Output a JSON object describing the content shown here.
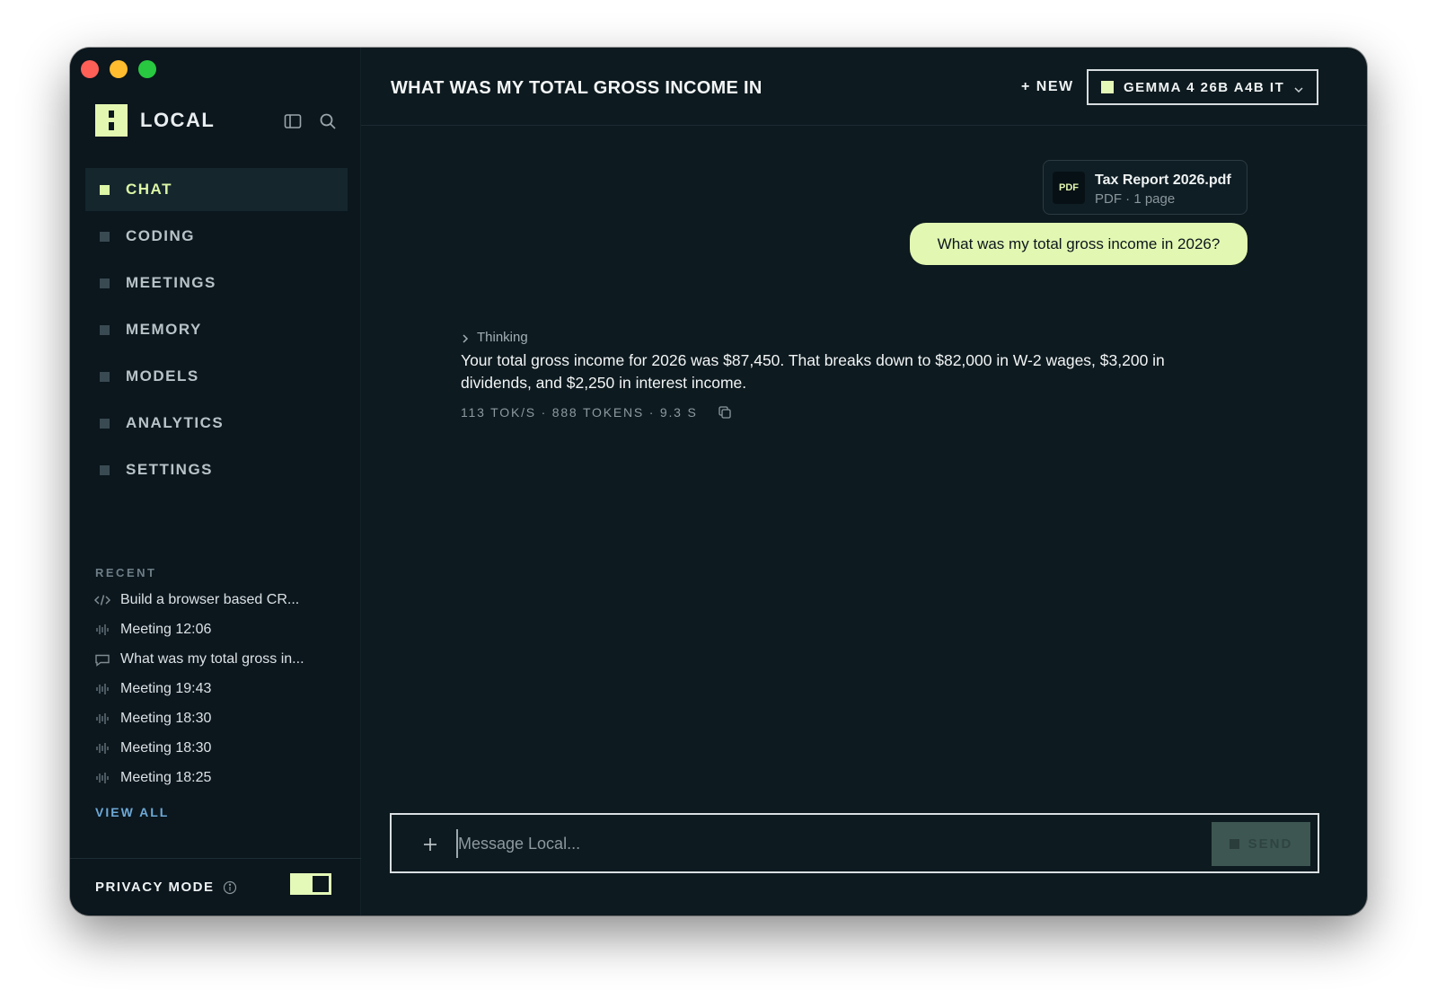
{
  "app": {
    "name": "LOCAL"
  },
  "sidebar": {
    "nav": [
      {
        "label": "CHAT",
        "active": true
      },
      {
        "label": "CODING",
        "active": false
      },
      {
        "label": "MEETINGS",
        "active": false
      },
      {
        "label": "MEMORY",
        "active": false
      },
      {
        "label": "MODELS",
        "active": false
      },
      {
        "label": "ANALYTICS",
        "active": false
      },
      {
        "label": "SETTINGS",
        "active": false
      }
    ],
    "recent_heading": "RECENT",
    "recent": [
      {
        "icon": "code-icon",
        "label": "Build a browser based CR..."
      },
      {
        "icon": "waveform-icon",
        "label": "Meeting 12:06"
      },
      {
        "icon": "chat-bubble-icon",
        "label": "What was my total gross in..."
      },
      {
        "icon": "waveform-icon",
        "label": "Meeting 19:43"
      },
      {
        "icon": "waveform-icon",
        "label": "Meeting 18:30"
      },
      {
        "icon": "waveform-icon",
        "label": "Meeting 18:30"
      },
      {
        "icon": "waveform-icon",
        "label": "Meeting 18:25"
      }
    ],
    "view_all": "VIEW ALL",
    "privacy_mode": {
      "label": "PRIVACY MODE",
      "enabled": true
    }
  },
  "header": {
    "title": "WHAT WAS MY TOTAL GROSS INCOME IN",
    "new_label": "+ NEW",
    "model": "GEMMA 4 26B A4B IT"
  },
  "conversation": {
    "attachment": {
      "badge": "PDF",
      "name": "Tax Report 2026.pdf",
      "meta": "PDF · 1 page"
    },
    "user_message": "What was my total gross income in 2026?",
    "thinking_label": "Thinking",
    "assistant_message": "Your total gross income for 2026 was $87,450. That breaks down to $82,000 in W-2 wages, $3,200 in dividends, and $2,250 in interest income.",
    "stats": "113 TOK/S · 888 TOKENS · 9.3 S"
  },
  "composer": {
    "placeholder": "Message Local...",
    "value": "",
    "send_label": "SEND"
  },
  "colors": {
    "accent": "#e2f7b1",
    "background": "#0d1a1f",
    "sidebar": "#0b161d",
    "link": "#6ea9d6"
  }
}
